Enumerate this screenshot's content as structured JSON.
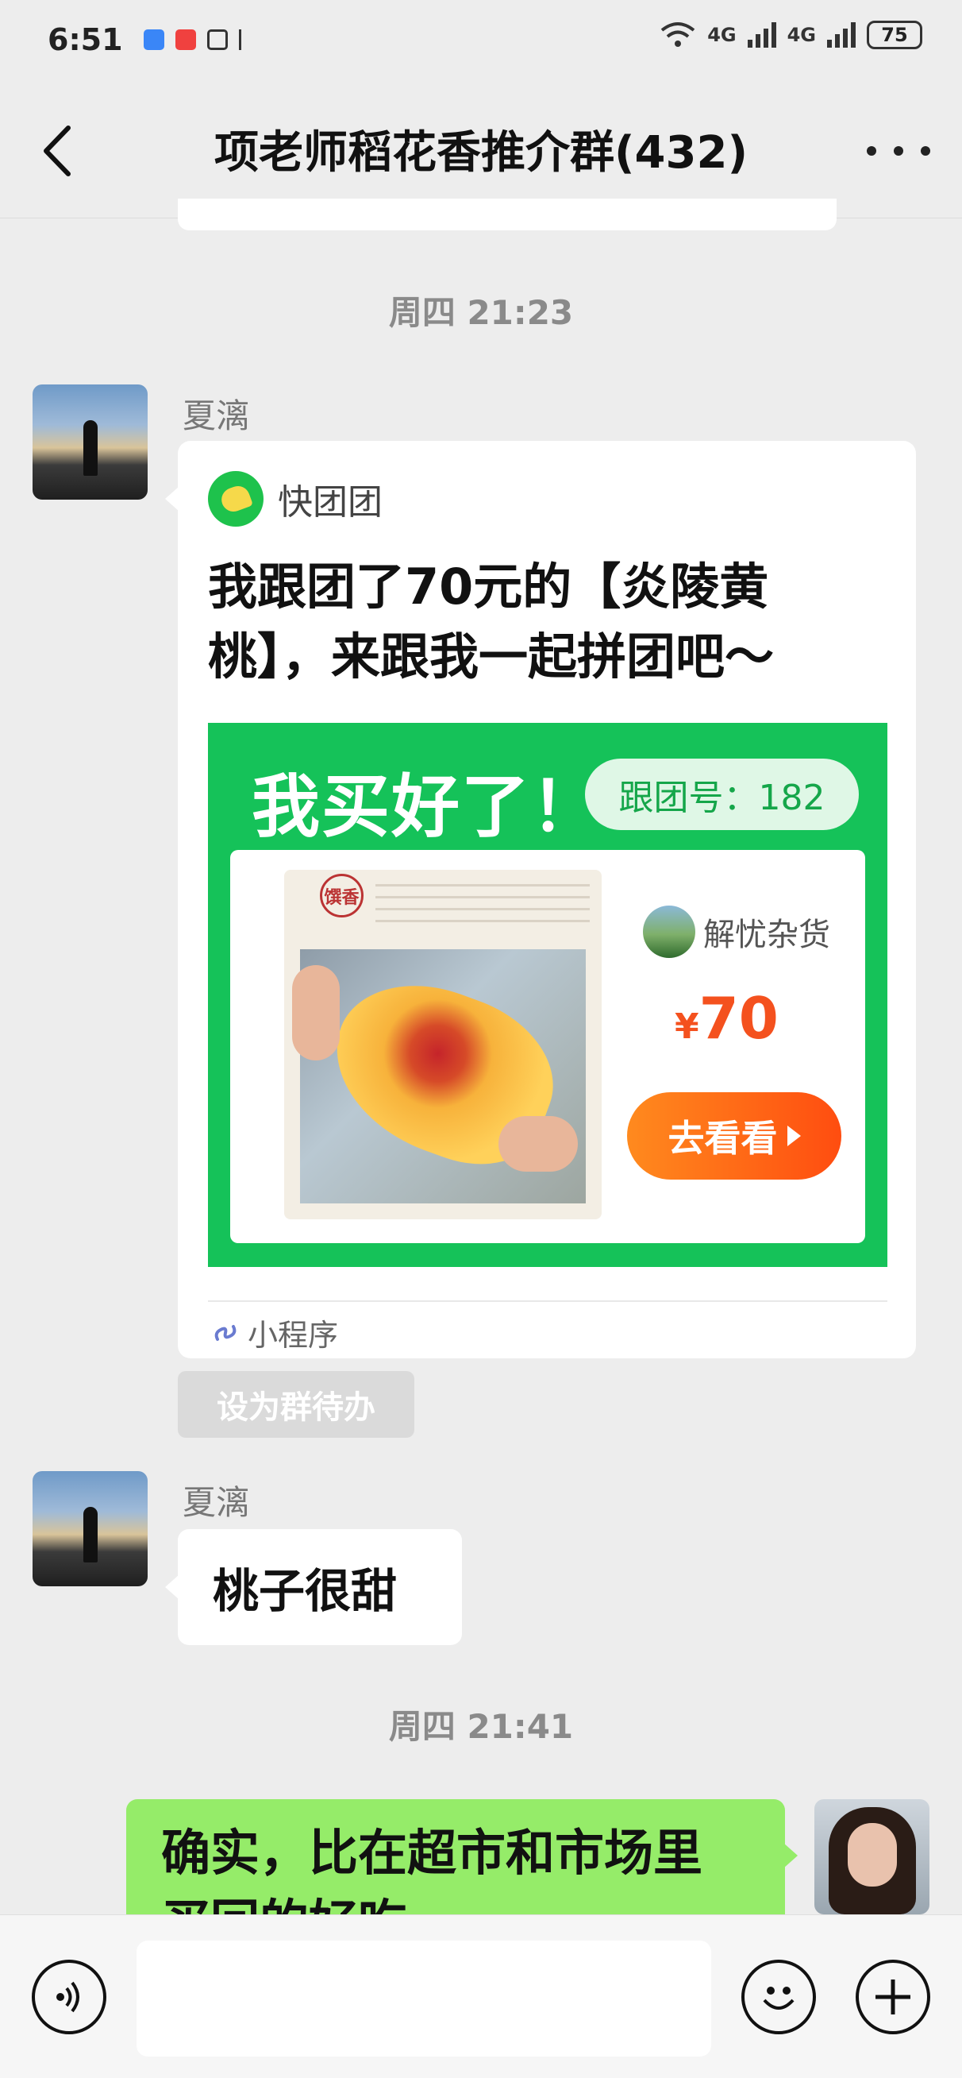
{
  "status": {
    "time": "6:51",
    "battery": "75",
    "net1": "4G",
    "net2": "4G"
  },
  "header": {
    "title": "项老师稻花香推介群(432)"
  },
  "timestamps": [
    "周四 21:23",
    "周四 21:41"
  ],
  "messages": [
    {
      "sender": "夏漓",
      "card": {
        "app_name": "快团团",
        "text": "我跟团了70元的【炎陵黄桃】，来跟我一起拼团吧～",
        "promo_title": "我买好了！",
        "group_no": "跟团号：182",
        "shop_name": "解忧杂货",
        "price_symbol": "¥",
        "price": "70",
        "go_label": "去看看",
        "mini_label": "小程序",
        "stamp": "馔香"
      },
      "todo_label": "设为群待办"
    },
    {
      "sender": "夏漓",
      "text": "桃子很甜"
    },
    {
      "sender": "me",
      "text": "确实，比在超市和市场里买回的好吃"
    }
  ],
  "colors": {
    "accent_green": "#15c259",
    "bubble_green": "#95ec69",
    "price_orange": "#f4511e"
  }
}
